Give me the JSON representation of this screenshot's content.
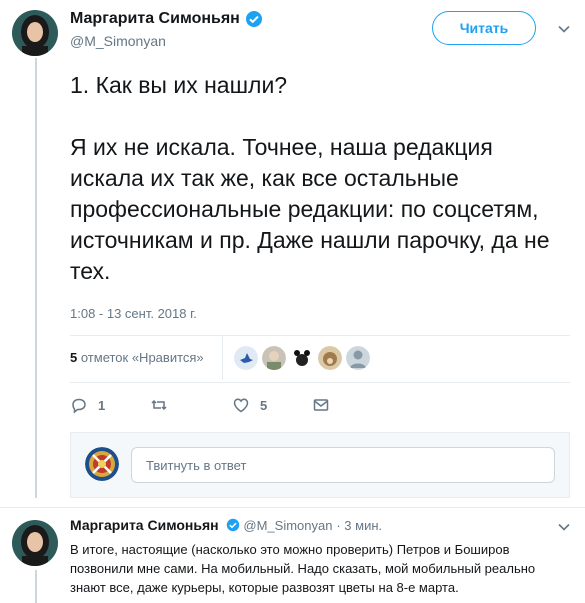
{
  "tweet": {
    "author_name": "Маргарита Симоньян",
    "author_handle": "@M_Simonyan",
    "follow_label": "Читать",
    "text": "1. Как вы их нашли?\n\nЯ их не искала. Точнее, наша редакция искала их так же, как все остальные профессиональные редакции: по соцсетям, источникам и пр. Даже нашли парочку, да не тех.",
    "timestamp": "1:08 - 13 сент. 2018 г.",
    "likes_count": "5",
    "likes_label": "отметок «Нравится»",
    "liker_avatars": [
      "bird-avatar",
      "man-avatar",
      "animal-avatar",
      "bear-avatar",
      "user-avatar",
      "default-avatar"
    ],
    "reply_count": "1",
    "retweet_count": "",
    "like_count": "5"
  },
  "reply_box": {
    "placeholder": "Твитнуть в ответ"
  },
  "thread_reply": {
    "author_name": "Маргарита Симоньян",
    "author_handle": "@M_Simonyan",
    "time": "· 3 мин.",
    "text": "В итоге, настоящие (насколько это можно проверить) Петров и Боширов позвонили мне сами. На мобильный. Надо сказать, мой мобильный реально знают все, даже курьеры, которые развозят цветы на 8-е марта."
  },
  "colors": {
    "accent": "#1da1f2",
    "verified": "#1da1f2",
    "muted": "#657786"
  }
}
